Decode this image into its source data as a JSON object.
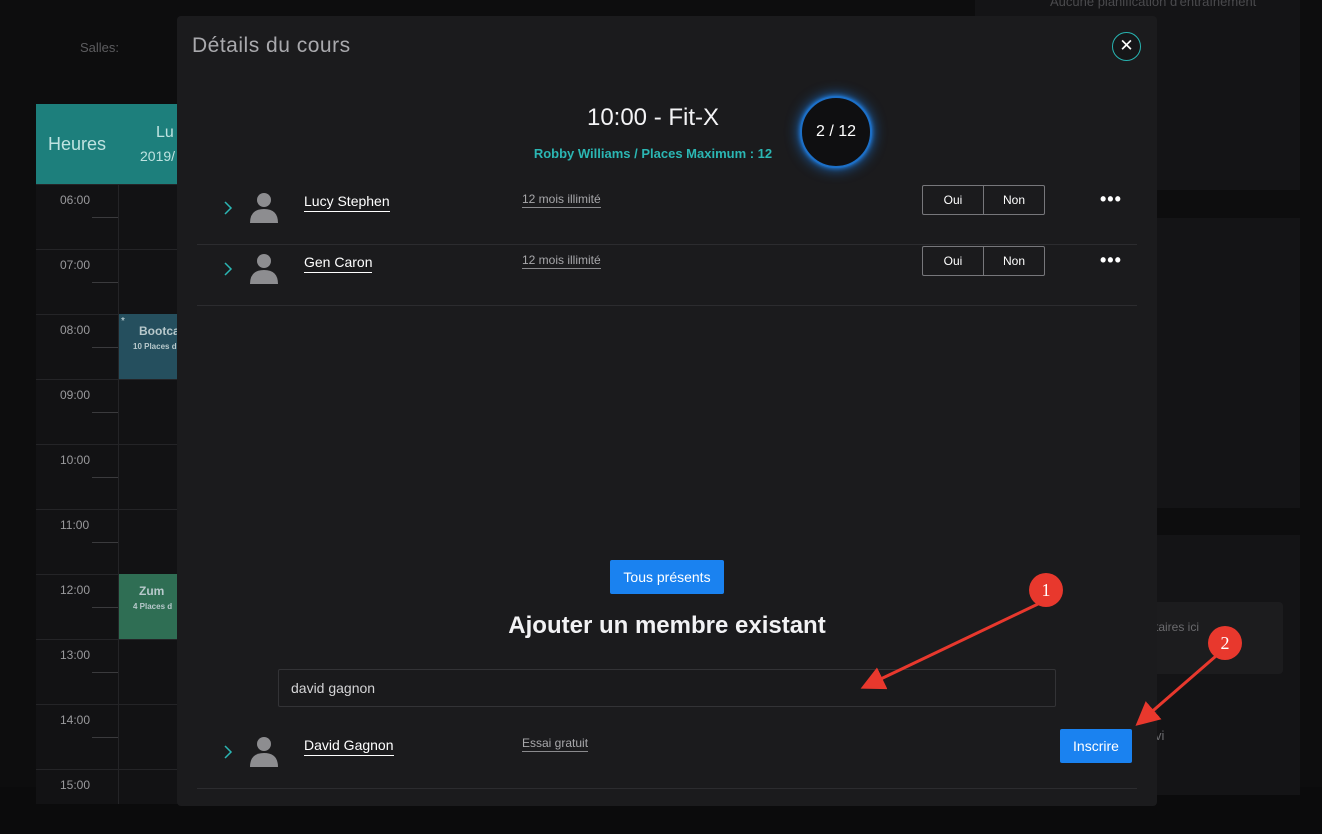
{
  "background": {
    "salles_label": "Salles:",
    "top_right_text": "Aucune planification d'entraînement",
    "right_box_text": "taires ici",
    "right_lower_text": "vi",
    "calendar": {
      "hours_header": "Heures",
      "day_header": "Lu",
      "date_header": "2019/",
      "times": [
        "06:00",
        "07:00",
        "08:00",
        "09:00",
        "10:00",
        "11:00",
        "12:00",
        "13:00",
        "14:00",
        "15:00"
      ],
      "events": [
        {
          "title": "Bootca",
          "subtitle": "10 Places d",
          "color": "#254f5e"
        },
        {
          "title": "Zum",
          "subtitle": "4 Places d",
          "color": "#2f6e54"
        }
      ]
    }
  },
  "modal": {
    "title": "Détails du cours",
    "close_icon": "close-icon",
    "class_title": "10:00 - Fit-X",
    "class_subtitle": "Robby Williams / Places Maximum : 12",
    "count": "2 / 12",
    "members": [
      {
        "name": "Lucy Stephen",
        "plan": "12 mois illimité",
        "yes": "Oui",
        "no": "Non",
        "more": "•••"
      },
      {
        "name": "Gen Caron",
        "plan": "12 mois illimité",
        "yes": "Oui",
        "no": "Non",
        "more": "•••"
      }
    ],
    "all_present_label": "Tous présents",
    "add_member_title": "Ajouter un membre existant",
    "search": {
      "value": "david gagnon",
      "placeholder": ""
    },
    "results": [
      {
        "name": "David Gagnon",
        "plan": "Essai gratuit",
        "action": "Inscrire"
      }
    ]
  },
  "annotations": {
    "markers": [
      "1",
      "2"
    ],
    "color": "#e8382d"
  },
  "colors": {
    "accent_teal": "#2bb6b3",
    "primary_blue": "#1a82f0"
  }
}
